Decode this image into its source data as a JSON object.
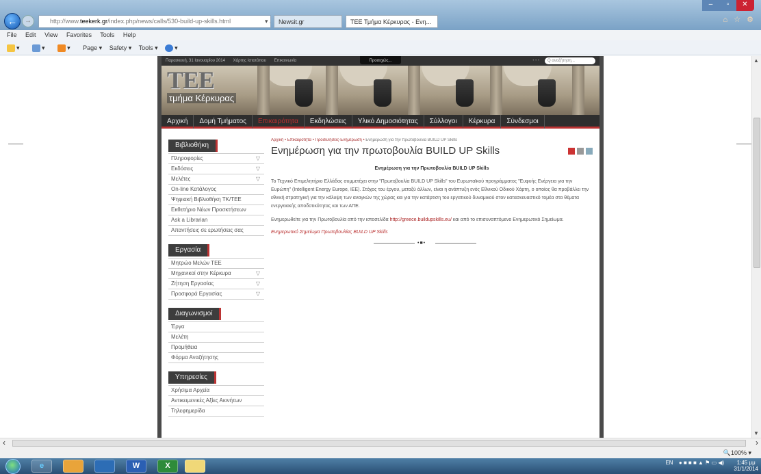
{
  "browser": {
    "url_prefix": "http://www.",
    "url_host": "teekerk.gr",
    "url_rest": "/index.php/news/calls/530-build-up-skills.html",
    "addr_icons": "▾ ⌕ C",
    "tab1_label": "Newsit.gr",
    "tab2_label": "TEE Τμήμα Κέρκυρας - Ενη...",
    "tab_close": "×",
    "window_minimize": "–",
    "window_maximize": "▫",
    "window_close": "✕",
    "toolbar_icons": "⌂ ☆ ⚙"
  },
  "menubar": {
    "items": [
      "File",
      "Edit",
      "View",
      "Favorites",
      "Tools",
      "Help"
    ]
  },
  "cmdbar": {
    "items": [
      "▾",
      "▾",
      "▾",
      "Page ▾",
      "Safety ▾",
      "Tools ▾",
      "▾"
    ]
  },
  "website": {
    "topstrip": {
      "date": "Παρασκευή, 31 Ιανουαρίου 2014",
      "link1": "Χάρτης Ιστοτόπου",
      "link2": "Επικοινωνία",
      "popup": "Προσεχώς...",
      "dots": "• • •",
      "search_placeholder": "Q αναζήτηση..."
    },
    "logo": {
      "big": "ΤΕΕ",
      "sub": "τμήμα Κέρκυρας"
    },
    "nav": [
      "Αρχική",
      "Δομή Τμήματος",
      "Επικαιρότητα",
      "Εκδηλώσεις",
      "Υλικό Δημοσιότητας",
      "Σύλλογοι",
      "Κέρκυρα",
      "Σύνδεσμοι"
    ],
    "sidebar": {
      "sections": [
        {
          "title": "Βιβλιοθήκη",
          "items": [
            {
              "label": "Πληροφορίες",
              "chev": "▽"
            },
            {
              "label": "Εκδόσεις",
              "chev": "▽"
            },
            {
              "label": "Μελέτες",
              "chev": "▽"
            },
            {
              "label": "On-line Κατάλογος",
              "chev": ""
            },
            {
              "label": "Ψηφιακή Βιβλιοθήκη ΤΚ/ΤΕΕ",
              "chev": ""
            },
            {
              "label": "Εκθετήριο Νέων Προσκτήσεων",
              "chev": ""
            },
            {
              "label": "Ask a Librarian",
              "chev": ""
            },
            {
              "label": "Απαντήσεις σε ερωτήσεις σας",
              "chev": ""
            }
          ]
        },
        {
          "title": "Εργασία",
          "items": [
            {
              "label": "Μητρώο Μελών ΤΕΕ",
              "chev": ""
            },
            {
              "label": "Μηχανικοί στην Κέρκυρα",
              "chev": "▽"
            },
            {
              "label": "Ζήτηση Εργασίας",
              "chev": "▽"
            },
            {
              "label": "Προσφορά Εργασίας",
              "chev": "▽"
            }
          ]
        },
        {
          "title": "Διαγωνισμοί",
          "items": [
            {
              "label": "Έργα",
              "chev": ""
            },
            {
              "label": "Μελέτη",
              "chev": ""
            },
            {
              "label": "Προμήθεια",
              "chev": ""
            },
            {
              "label": "Φόρμα Αναζήτησης",
              "chev": ""
            }
          ]
        },
        {
          "title": "Υπηρεσίες",
          "items": [
            {
              "label": "Χρήσιμα Αρχεία",
              "chev": ""
            },
            {
              "label": "Αντικειμενικές Αξίες Ακινήτων",
              "chev": ""
            },
            {
              "label": "Τηλεφημερίδα",
              "chev": ""
            }
          ]
        }
      ]
    },
    "article": {
      "breadcrumb": [
        "Αρχική",
        "Επικαιρότητα",
        "Προσκλήσεις-Ενημέρωση"
      ],
      "breadcrumb_sep": "•",
      "breadcrumb_current": "Ενημέρωση για την πρωτοβουλία BUILD UP Skills",
      "title": "Ενημέρωση για την πρωτοβουλία BUILD UP Skills",
      "subheading": "Ενημέρωση για την Πρωτοβουλία BUILD UP Skills",
      "para1": "Το Τεχνικό Επιμελητήριο Ελλάδας συμμετέχει στην \"Πρωτοβουλία BUILD UP Skills\" του Ευρωπαϊκού προγράμματος \"Ευφυής Ενέργεια για την Ευρώπη\" (Intelligent Energy Europe, IEE). Στόχος του έργου, μεταξύ άλλων, είναι η ανάπτυξη ενός Εθνικού Οδικού Χάρτη, ο οποίος θα προβάλλει την εθνική στρατηγική για την κάλυψη των αναγκών της χώρας και για την κατάρτιση του εργατικού δυναμικού στον κατασκευαστικό τομέα στα θέματα ενεργειακής αποδοτικότητας και των ΑΠΕ.",
      "para2_before": "Ενημερωθείτε για την Πρωτοβουλία από την ιστοσελίδα ",
      "para2_link": "http://greece.buildupskills.eu/",
      "para2_after": " και από το επισυναπτόμενο Ενημερωτικό Σημείωμα.",
      "attachment": "Ενημερωτικό Σημείωμα Πρωτοβουλίας BUILD UP Skills",
      "separator_mark": "•■•"
    }
  },
  "statusbar": {
    "zoom": "🔍100% ▾"
  },
  "taskbar": {
    "apps": [
      "e",
      "",
      "",
      "W",
      "X",
      ""
    ],
    "lang": "EN",
    "time": "1:45 μμ",
    "date": "31/1/2014"
  }
}
